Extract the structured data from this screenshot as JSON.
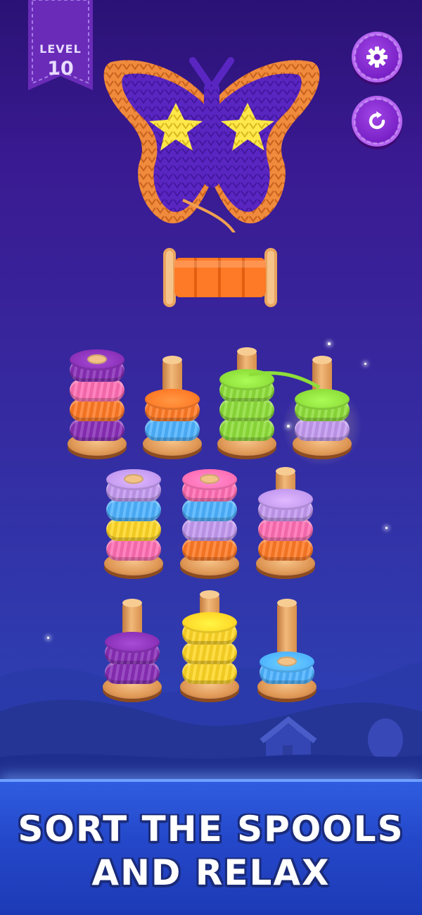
{
  "level": {
    "label": "LEVEL",
    "number": "10"
  },
  "buttons": {
    "settings_icon": "gear-icon",
    "restart_icon": "restart-icon"
  },
  "artwork": {
    "icon": "butterfly-knit-pattern",
    "colors": {
      "outline": "#f08a3c",
      "body": "#5a26c2",
      "accent": "#ffe84a"
    }
  },
  "banner": {
    "line1": "SORT THE SPOOLS",
    "line2": "AND RELAX"
  },
  "colors": {
    "purple": "#8a2fb8",
    "pink": "#ff6fb4",
    "orange": "#ff7a26",
    "blue": "#4fb3ff",
    "green": "#8ede3a",
    "lilac": "#c39af0",
    "yellow": "#ffd726"
  },
  "pegs": [
    {
      "rings": [
        "purple",
        "orange",
        "pink",
        "purple"
      ]
    },
    {
      "rings": [
        "blue",
        "orange"
      ]
    },
    {
      "rings": [
        "green",
        "green",
        "green"
      ]
    },
    {
      "rings": [
        "lilac",
        "green"
      ],
      "selected": true
    },
    {
      "rings": [
        "pink",
        "yellow",
        "blue",
        "lilac"
      ]
    },
    {
      "rings": [
        "orange",
        "lilac",
        "blue",
        "pink"
      ]
    },
    {
      "rings": [
        "orange",
        "pink",
        "lilac"
      ]
    },
    {
      "rings": [
        "purple",
        "purple"
      ]
    },
    {
      "rings": [
        "yellow",
        "yellow",
        "yellow"
      ]
    },
    {
      "rings": [
        "blue"
      ]
    }
  ]
}
